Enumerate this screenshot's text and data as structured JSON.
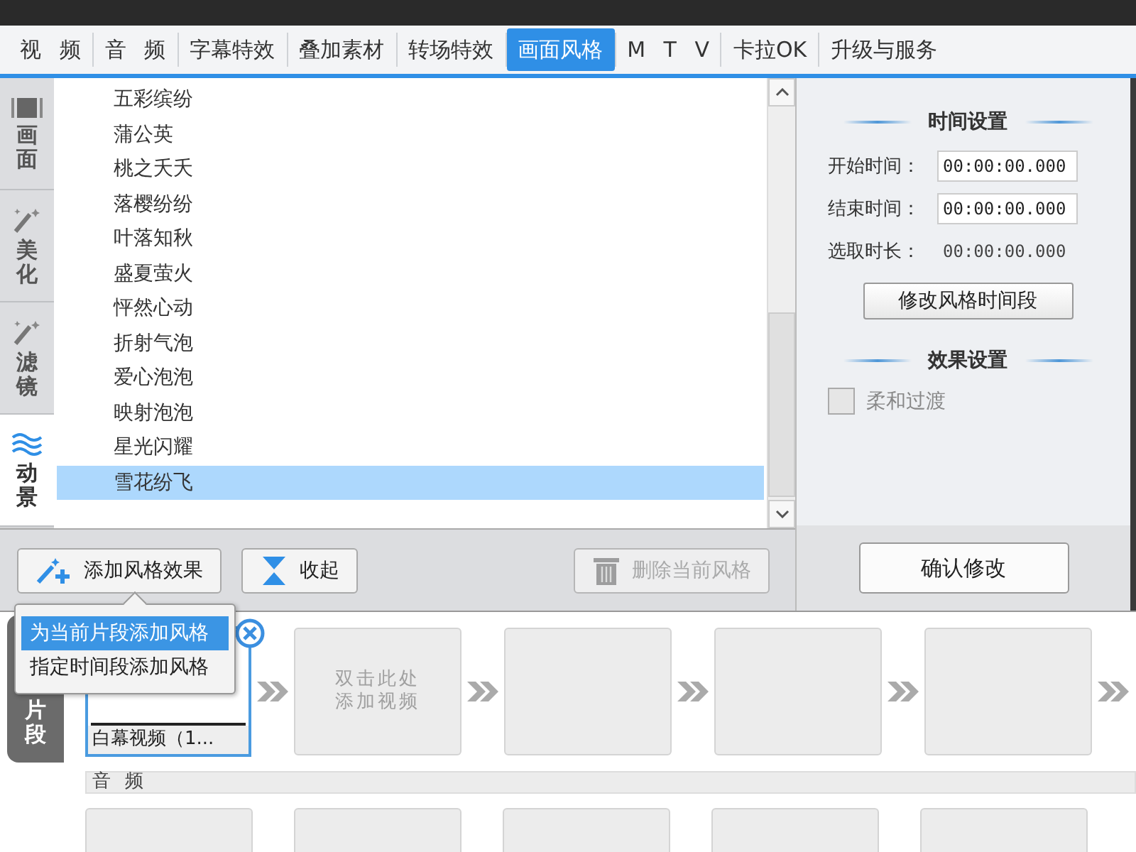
{
  "tabs": [
    {
      "label": "视 频",
      "selected": false
    },
    {
      "label": "音 频",
      "selected": false
    },
    {
      "label": "字幕特效",
      "selected": false
    },
    {
      "label": "叠加素材",
      "selected": false
    },
    {
      "label": "转场特效",
      "selected": false
    },
    {
      "label": "画面风格",
      "selected": true
    },
    {
      "label": "M T V",
      "selected": false
    },
    {
      "label": "卡拉OK",
      "selected": false
    },
    {
      "label": "升级与服务",
      "selected": false
    }
  ],
  "side_tabs": [
    {
      "label": "画面",
      "kind": "film",
      "selected": false
    },
    {
      "label": "美化",
      "kind": "wand",
      "selected": false
    },
    {
      "label": "滤镜",
      "kind": "wand",
      "selected": false
    },
    {
      "label": "动景",
      "kind": "waves",
      "selected": true
    }
  ],
  "style_list": [
    {
      "label": "五彩缤纷",
      "selected": false
    },
    {
      "label": "蒲公英",
      "selected": false
    },
    {
      "label": "桃之夭夭",
      "selected": false
    },
    {
      "label": "落樱纷纷",
      "selected": false
    },
    {
      "label": "叶落知秋",
      "selected": false
    },
    {
      "label": "盛夏萤火",
      "selected": false
    },
    {
      "label": "怦然心动",
      "selected": false
    },
    {
      "label": "折射气泡",
      "selected": false
    },
    {
      "label": "爱心泡泡",
      "selected": false
    },
    {
      "label": "映射泡泡",
      "selected": false
    },
    {
      "label": "星光闪耀",
      "selected": false
    },
    {
      "label": "雪花纷飞",
      "selected": true
    }
  ],
  "toolbar": [
    {
      "label": "添加风格效果",
      "kind": "add",
      "disabled": false
    },
    {
      "label": "收起",
      "kind": "collapse",
      "disabled": false
    },
    {
      "label": "删除当前风格",
      "kind": "delete",
      "disabled": true
    }
  ],
  "popup_menu": [
    {
      "label": "为当前片段添加风格",
      "selected": true
    },
    {
      "label": "指定时间段添加风格",
      "selected": false
    }
  ],
  "time_settings": {
    "title": "时间设置",
    "fields": [
      {
        "label": "开始时间：",
        "value": "00:00:00.000",
        "kind": "input"
      },
      {
        "label": "结束时间：",
        "value": "00:00:00.000",
        "kind": "input"
      },
      {
        "label": "选取时长：",
        "value": "00:00:00.000",
        "kind": "text"
      }
    ],
    "button": "修改风格时间段"
  },
  "effect_settings": {
    "title": "效果设置",
    "checkbox": {
      "label": "柔和过渡",
      "checked": false,
      "disabled": true
    }
  },
  "confirm_button": "确认修改",
  "timeline": {
    "side_tab": "片段",
    "video_slots": [
      {
        "kind": "clip",
        "caption": "白幕视频（1..."
      },
      {
        "kind": "hint",
        "lines": [
          "双击此处",
          "添加视频"
        ]
      },
      {
        "kind": "empty"
      },
      {
        "kind": "empty"
      },
      {
        "kind": "empty"
      }
    ],
    "audio_label": "音 频",
    "audio_slots": [
      {
        "kind": "empty"
      },
      {
        "kind": "empty"
      },
      {
        "kind": "empty"
      },
      {
        "kind": "empty"
      },
      {
        "kind": "empty"
      }
    ]
  }
}
